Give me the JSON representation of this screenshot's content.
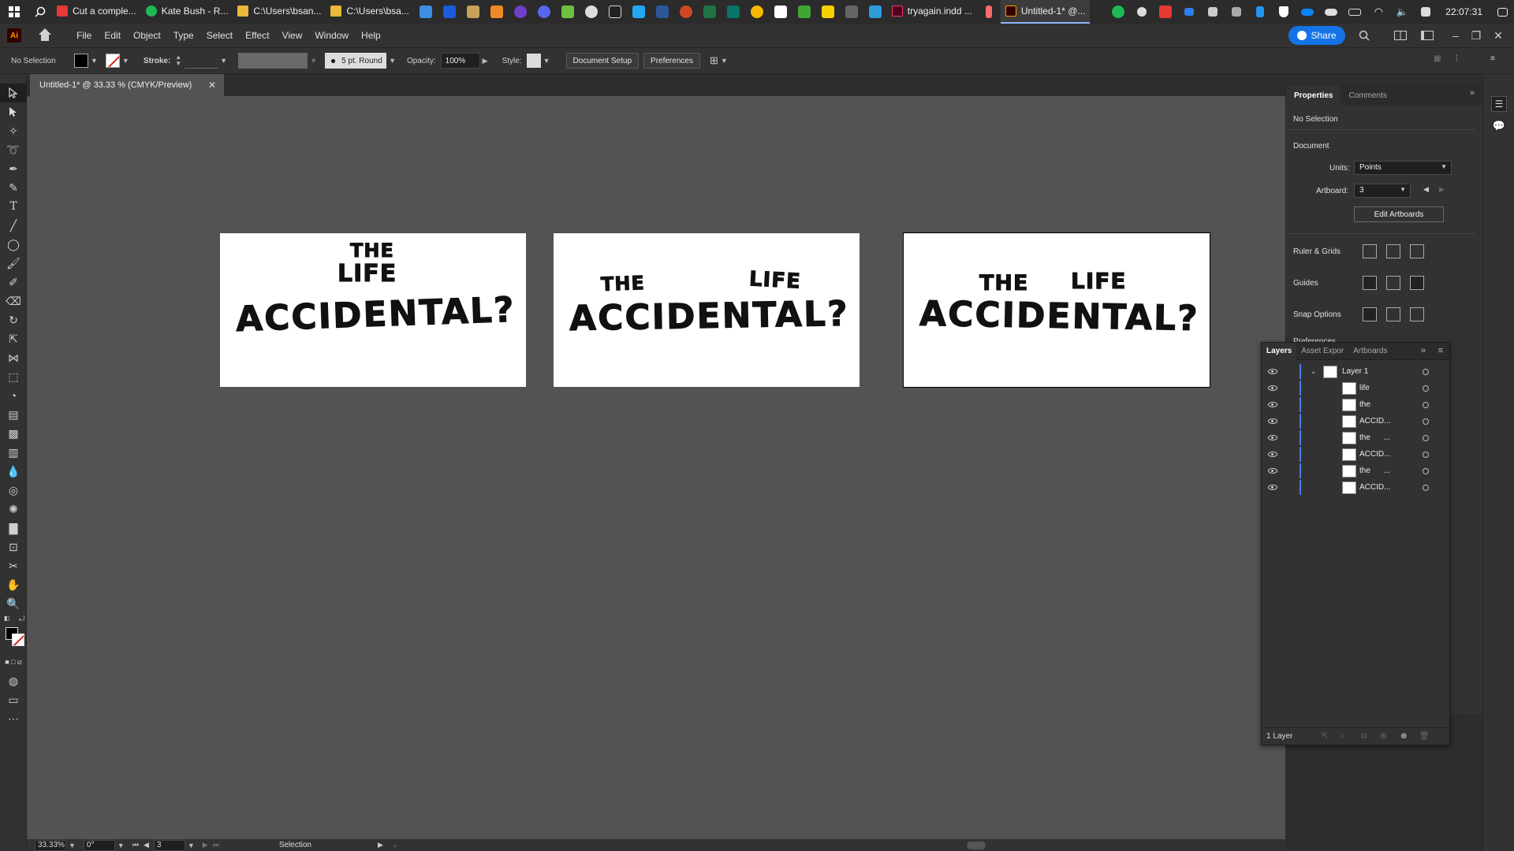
{
  "taskbar": {
    "apps": [
      {
        "label": "Cut a comple...",
        "color": "#e53935"
      },
      {
        "label": "Kate Bush - R...",
        "color": "#1db954"
      },
      {
        "label": "C:\\Users\\bsan...",
        "color": "#e8b93a"
      },
      {
        "label": "C:\\Users\\bsa...",
        "color": "#e8b93a"
      }
    ],
    "indesign": {
      "label": "tryagain.indd ...",
      "color": "#ff3366"
    },
    "illustrator": {
      "label": "Untitled-1* @...",
      "color": "#ff9a00"
    },
    "clock": "22:07:31"
  },
  "menubar": {
    "items": [
      "File",
      "Edit",
      "Object",
      "Type",
      "Select",
      "Effect",
      "View",
      "Window",
      "Help"
    ],
    "share_label": "Share"
  },
  "control": {
    "selection": "No Selection",
    "stroke_label": "Stroke:",
    "brush": "5 pt. Round",
    "opacity_label": "Opacity:",
    "opacity": "100%",
    "style_label": "Style:",
    "doc_setup": "Document Setup",
    "preferences": "Preferences"
  },
  "doc_tab": {
    "title": "Untitled-1* @ 33.33 % (CMYK/Preview)"
  },
  "artboards": [
    {
      "the": "THE",
      "life": "LIFE",
      "acc": "ACCIDENTAL?"
    },
    {
      "the": "THE",
      "life": "LIFE",
      "acc": "ACCIDENTAL?"
    },
    {
      "the": "THE",
      "life": "LIFE",
      "acc": "ACCIDENTAL?"
    }
  ],
  "status": {
    "zoom": "33.33%",
    "rotate": "0°",
    "artboard": "3",
    "tool": "Selection"
  },
  "properties": {
    "tabs": [
      "Properties",
      "Comments"
    ],
    "selection": "No Selection",
    "document_heading": "Document",
    "units_label": "Units:",
    "units": "Points",
    "artboard_label": "Artboard:",
    "artboard": "3",
    "edit_artboards": "Edit Artboards",
    "rulers": "Ruler & Grids",
    "guides": "Guides",
    "snap": "Snap Options",
    "preferences": "Preferences"
  },
  "layers": {
    "tabs": [
      "Layers",
      "Asset Expor",
      "Artboards"
    ],
    "rows": [
      {
        "name": "Layer 1",
        "kind": "layer"
      },
      {
        "name": "life",
        "kind": "item"
      },
      {
        "name": "the",
        "kind": "item"
      },
      {
        "name": "ACCID...",
        "kind": "item"
      },
      {
        "name": "the      ...",
        "kind": "item"
      },
      {
        "name": "ACCID...",
        "kind": "item"
      },
      {
        "name": "the      ...",
        "kind": "item"
      },
      {
        "name": "ACCID...",
        "kind": "item"
      }
    ],
    "footer": "1 Layer"
  }
}
